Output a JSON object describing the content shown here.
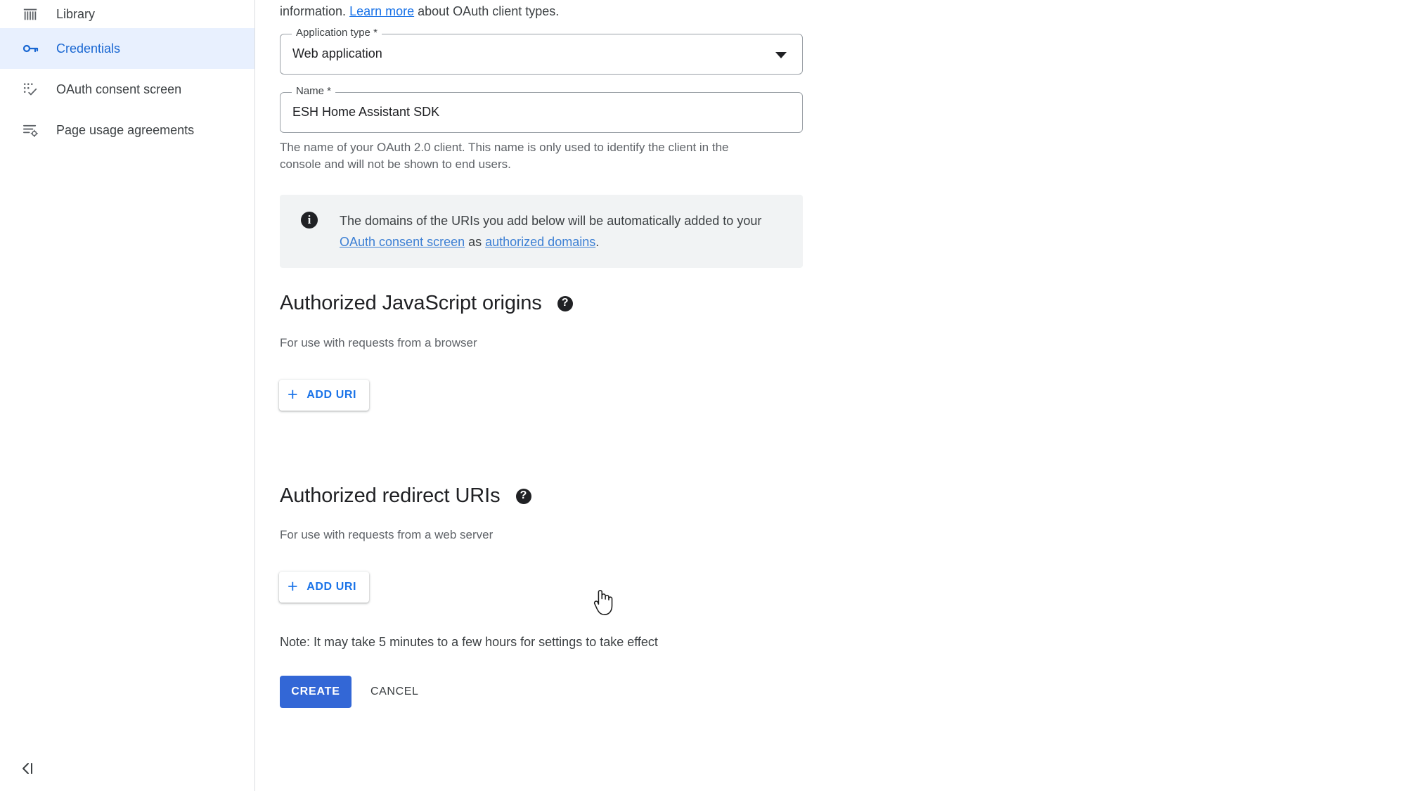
{
  "sidebar": {
    "items": [
      {
        "label": "Library",
        "icon": "library-icon",
        "active": false
      },
      {
        "label": "Credentials",
        "icon": "key-icon",
        "active": true
      },
      {
        "label": "OAuth consent screen",
        "icon": "consent-screen-icon",
        "active": false
      },
      {
        "label": "Page usage agreements",
        "icon": "agreements-icon",
        "active": false
      }
    ],
    "collapse_icon": "collapse-panel-icon"
  },
  "main": {
    "intro": {
      "prefix": "information.",
      "link": "Learn more",
      "suffix": "about OAuth client types."
    },
    "fields": {
      "application_type": {
        "label": "Application type *",
        "value": "Web application",
        "caret_icon": "chevron-down-icon"
      },
      "name": {
        "label": "Name *",
        "value": "ESH Home Assistant SDK",
        "helper": "The name of your OAuth 2.0 client. This name is only used to identify the client in the console and will not be shown to end users."
      }
    },
    "info_banner": {
      "icon": "info-icon",
      "text_part1": "The domains of the URIs you add below will be automatically added to your ",
      "link1": "OAuth consent screen",
      "text_part2": " as ",
      "link2": "authorized domains",
      "text_part3": "."
    },
    "sections": [
      {
        "title": "Authorized JavaScript origins",
        "help_icon": "help-icon",
        "subtitle": "For use with requests from a browser",
        "add_button": "ADD URI",
        "add_icon": "plus-icon"
      },
      {
        "title": "Authorized redirect URIs",
        "help_icon": "help-icon",
        "subtitle": "For use with requests from a web server",
        "add_button": "ADD URI",
        "add_icon": "plus-icon"
      }
    ],
    "note": "Note: It may take 5 minutes to a few hours for settings to take effect",
    "actions": {
      "create": "CREATE",
      "cancel": "CANCEL"
    }
  },
  "colors": {
    "accent_blue": "#1a73e8",
    "active_nav_bg": "#e8f0fe",
    "active_nav_fg": "#1967d2",
    "primary_button": "#3367d6",
    "banner_bg": "#f1f3f4",
    "text_primary": "#202124",
    "text_secondary": "#5f6368"
  }
}
